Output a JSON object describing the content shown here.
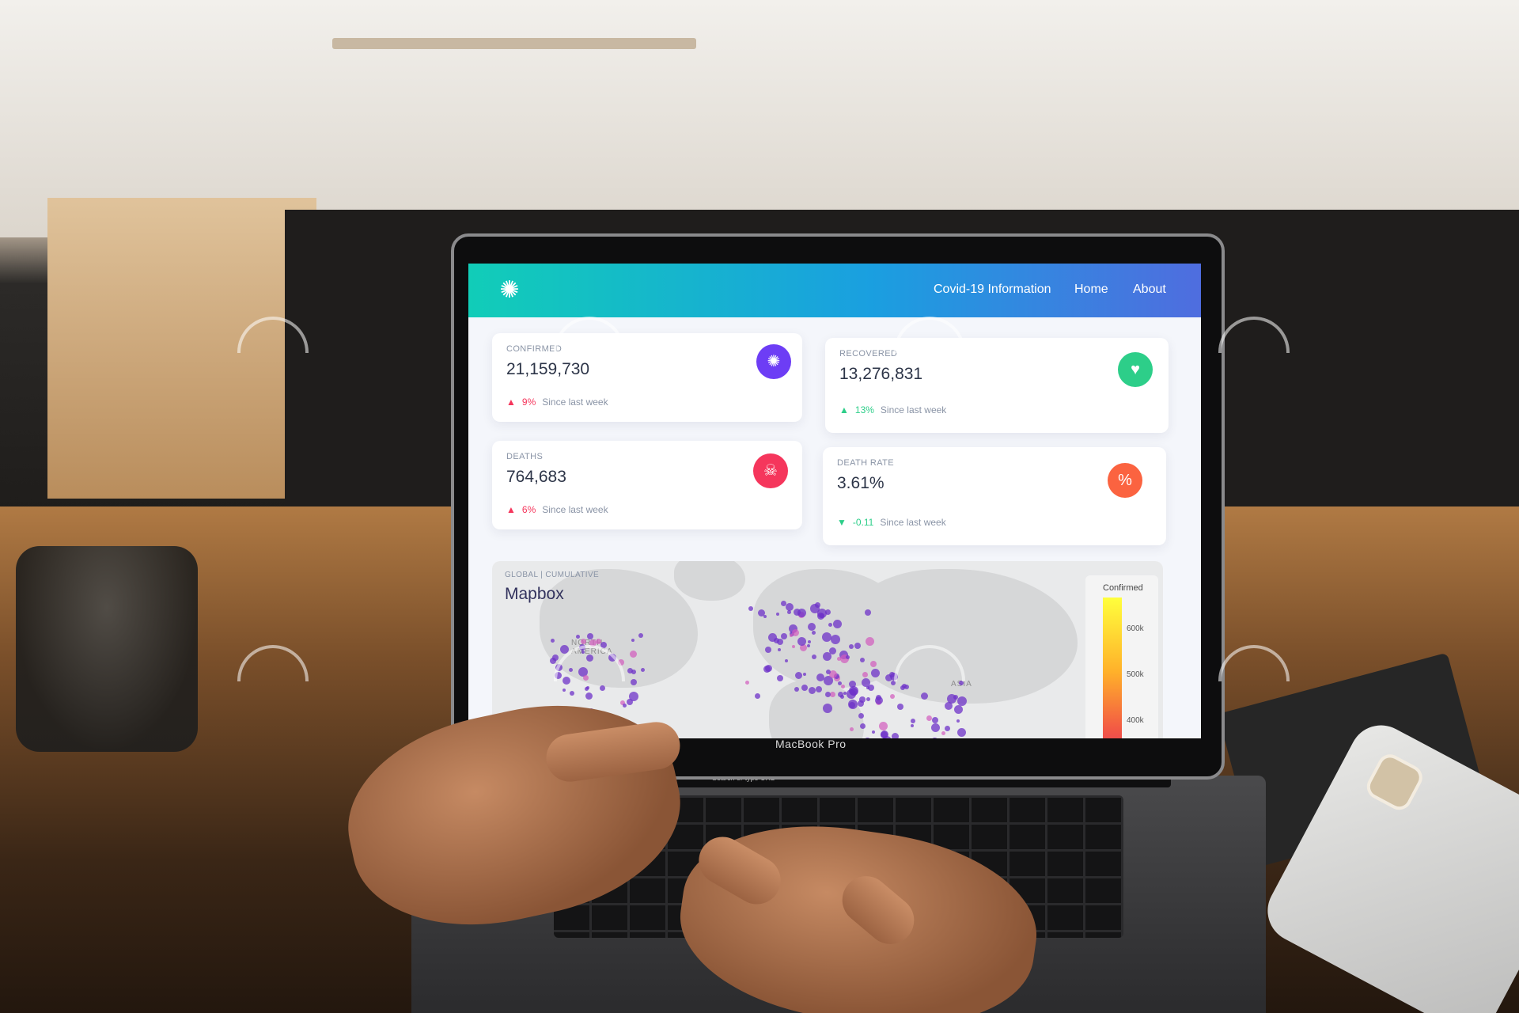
{
  "app": {
    "logo_icon": "virus-icon",
    "nav": {
      "covid_info": "Covid-19 Information",
      "home": "Home",
      "about": "About"
    },
    "colors": {
      "nav_gradient_start": "#11cdb8",
      "nav_gradient_end": "#4f6ddf",
      "confirmed_icon_bg": "#6d3df5",
      "recovered_icon_bg": "#2dce89",
      "deaths_icon_bg": "#f5365c",
      "death_rate_icon_bg": "#fb6340"
    }
  },
  "stats": {
    "confirmed": {
      "label": "Confirmed",
      "value": "21,159,730",
      "delta": "9%",
      "delta_dir": "up",
      "since": "Since last week",
      "icon": "virus-icon"
    },
    "recovered": {
      "label": "Recovered",
      "value": "13,276,831",
      "delta": "13%",
      "delta_dir": "up",
      "since": "Since last week",
      "icon": "heart-icon"
    },
    "deaths": {
      "label": "Deaths",
      "value": "764,683",
      "delta": "6%",
      "delta_dir": "up",
      "since": "Since last week",
      "icon": "skull-icon"
    },
    "death_rate": {
      "label": "Death Rate",
      "value": "3.61%",
      "delta": "-0.11",
      "delta_dir": "down",
      "since": "Since last week",
      "icon": "percent-icon"
    }
  },
  "map": {
    "breadcrumb": "Global | Cumulative",
    "title": "Mapbox",
    "labels": {
      "north_america": "North America",
      "asia": "Asia"
    },
    "legend": {
      "title": "Confirmed",
      "ticks": [
        "600k",
        "500k",
        "400k"
      ]
    }
  },
  "device": {
    "brand": "MacBook Pro",
    "touchbar_search": "Search or type URL"
  }
}
